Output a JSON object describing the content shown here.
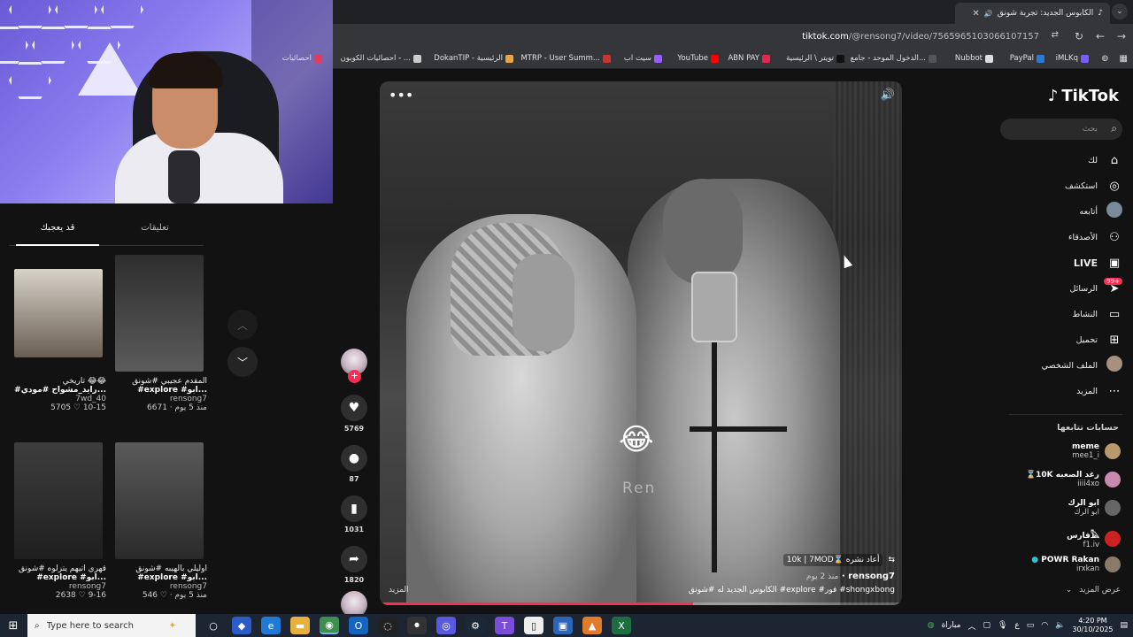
{
  "browser": {
    "tab_title": "الكابوس الجديد: تجربة شونق",
    "url_host": "tiktok.com",
    "url_path": "/@rensong7/video/7565965103066107157",
    "bookmarks": [
      {
        "label": "iMLKq",
        "color": "#7b5cff"
      },
      {
        "label": "PayPal",
        "color": "#2a7bd5"
      },
      {
        "label": "Nubbot",
        "color": "#dddddd"
      },
      {
        "label": "الدخول الموحد - جامع...",
        "color": "#555555"
      },
      {
        "label": "تويتر \\ الرئيسية",
        "color": "#111111"
      },
      {
        "label": "ABN PAY",
        "color": "#e02a4b"
      },
      {
        "label": "YouTube",
        "color": "#ff0000"
      },
      {
        "label": "سيت اب",
        "color": "#9a5cff"
      },
      {
        "label": "MTRP - User Summ...",
        "color": "#cc3333"
      },
      {
        "label": "DokanTIP - الرئيسية",
        "color": "#e7a640"
      },
      {
        "label": "احصائيات الكوبون - ...",
        "color": "#cccccc"
      },
      {
        "label": "احصائيات",
        "color": "#e33b5c"
      }
    ]
  },
  "left_panel": {
    "tabs": [
      "تعليقات",
      "قد يعجبك"
    ],
    "cards": [
      {
        "title": "المقدم عجيبي #شونق",
        "tags": "#explore #ابو...",
        "user": "rensong7",
        "stats": "6671 · منذ 5 يوم",
        "thumb": "#3a3a3a"
      },
      {
        "title": "تاريخي 😂😂",
        "tags": "#رايد_مشواح #مودي...",
        "user": "7wd_40",
        "stats": "5705 ♡ 10-15",
        "thumb": "#5a5046"
      },
      {
        "title": "اوليلي بالهيبه #شونق",
        "tags": "#explore #ابو...",
        "user": "rensong7",
        "stats": "546 ♡ · منذ 5 يوم",
        "thumb": "#4d4d4d"
      },
      {
        "title": "قهري اتيهم يتزلوه #شونق",
        "tags": "#explore #ابو...",
        "user": "rensong7",
        "stats": "2638 ♡ 9-16",
        "thumb": "#2f2f2f"
      }
    ]
  },
  "video": {
    "watermark": "Ren",
    "emoji": "😂",
    "repost_text": "10k | 7MOD⌛ أعاد نشره",
    "username": "rensong7",
    "posted": "منذ 2 يوم",
    "caption": "الكابوس الجديد له #شونق #explore #فور #shongxbong",
    "more_label": "المزيد",
    "progress": 0.6
  },
  "actions": {
    "likes": "5769",
    "comments": "87",
    "saves": "1031",
    "shares": "1820"
  },
  "sidebar": {
    "logo": "TikTok",
    "search_placeholder": "بحث",
    "nav": [
      {
        "label": "لك",
        "icon": "home-icon"
      },
      {
        "label": "استكشف",
        "icon": "compass-icon"
      },
      {
        "label": "أتابعه",
        "icon": "avatar-icon"
      },
      {
        "label": "الأصدقاء",
        "icon": "friends-icon"
      },
      {
        "label": "LIVE",
        "icon": "live-icon"
      },
      {
        "label": "الرسائل",
        "icon": "messages-icon",
        "badge": "99+"
      },
      {
        "label": "النشاط",
        "icon": "activity-icon"
      },
      {
        "label": "تحميل",
        "icon": "upload-icon"
      },
      {
        "label": "الملف الشخصي",
        "icon": "profile-icon"
      },
      {
        "label": "المزيد",
        "icon": "more-icon"
      }
    ],
    "following_header": "حسابات تتابعها",
    "following": [
      {
        "n1": "meme",
        "n2": "mee1_i",
        "color": "#b89a6a"
      },
      {
        "n1": "⌛10K رغد الصعبه",
        "n2": "iiii4xo",
        "color": "#c98ab0"
      },
      {
        "n1": "ابو الرك",
        "n2": "ابو الرك",
        "color": "#666666"
      },
      {
        "n1": "فارس𓅓",
        "n2": "f1.iv",
        "color": "#cc2222"
      },
      {
        "n1": "POWR Rakan",
        "n2": "irxkan",
        "color": "#8a7a6a"
      }
    ],
    "see_more": "عرض المزيد"
  },
  "taskbar": {
    "search_placeholder": "Type here to search",
    "weather": "مباراة",
    "lang": "ع",
    "time": "4:20 PM",
    "date": "30/10/2025"
  }
}
